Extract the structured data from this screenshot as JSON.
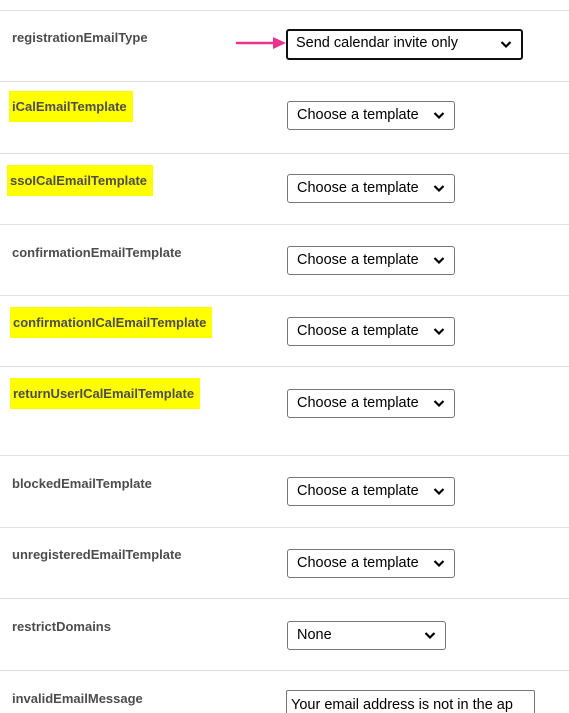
{
  "settings": {
    "registration_email_type": {
      "label": "registrationEmailType",
      "value": "Send calendar invite only"
    },
    "ical_email_template": {
      "label": "iCalEmailTemplate",
      "value": "Choose a template"
    },
    "sso_ical_email_template": {
      "label": "ssoICalEmailTemplate",
      "value": "Choose a template"
    },
    "confirmation_email_template": {
      "label": "confirmationEmailTemplate",
      "value": "Choose a template"
    },
    "confirmation_ical_email_template": {
      "label": "confirmationICalEmailTemplate",
      "value": "Choose a template"
    },
    "return_user_ical_email_template": {
      "label": "returnUserICalEmailTemplate",
      "value": "Choose a template"
    },
    "blocked_email_template": {
      "label": "blockedEmailTemplate",
      "value": "Choose a template"
    },
    "unregistered_email_template": {
      "label": "unregisteredEmailTemplate",
      "value": "Choose a template"
    },
    "restrict_domains": {
      "label": "restrictDomains",
      "value": "None"
    },
    "invalid_email_message": {
      "label": "invalidEmailMessage",
      "value": "Your email address is not in the ap"
    }
  },
  "colors": {
    "highlight": "#ffff00",
    "annotation_arrow": "#e8348c",
    "label_text": "#4d4d4d",
    "divider": "#e2e2e2"
  },
  "icons": {
    "select_chevron": "chevron-down-icon",
    "annotation": "arrow-right-icon"
  }
}
